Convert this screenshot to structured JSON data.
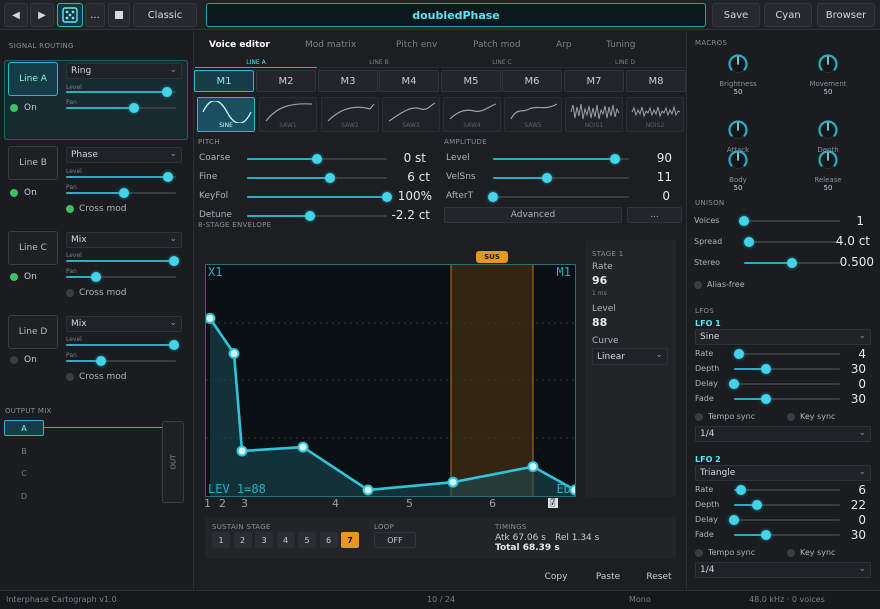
{
  "toolbar": {
    "prev_icon": "play-prev",
    "play_icon": "play",
    "dice_icon": "dice",
    "more_label": "...",
    "stop_icon": "stop",
    "preset_label": "Classic",
    "title": "doubledPhase",
    "save_label": "Save",
    "theme_label": "Cyan",
    "browser_label": "Browser"
  },
  "signal_routing": {
    "title": "SIGNAL ROUTING",
    "lines": [
      {
        "label": "Line A",
        "mode": "Ring",
        "on_label": "On",
        "on": true,
        "level_label": "Level",
        "pan_label": "Pan",
        "level": 0.92,
        "pan": 0.62,
        "cross_mod": null
      },
      {
        "label": "Line B",
        "mode": "Phase",
        "on_label": "On",
        "on": true,
        "level_label": "Level",
        "pan_label": "Pan",
        "level": 0.93,
        "pan": 0.53,
        "cross_mod": {
          "label": "Cross mod",
          "on": true
        }
      },
      {
        "label": "Line C",
        "mode": "Mix",
        "on_label": "On",
        "on": true,
        "level_label": "Level",
        "pan_label": "Pan",
        "level": 0.98,
        "pan": 0.27,
        "cross_mod": {
          "label": "Cross mod",
          "on": false
        }
      },
      {
        "label": "Line D",
        "mode": "Mix",
        "on_label": "On",
        "on": false,
        "level_label": "Level",
        "pan_label": "Pan",
        "level": 0.98,
        "pan": 0.32,
        "cross_mod": {
          "label": "Cross mod",
          "on": false
        }
      }
    ]
  },
  "output_mix": {
    "title": "OUTPUT MIX",
    "buttons": [
      "A",
      "B",
      "C",
      "D"
    ],
    "active": "A",
    "out_label": "OUT"
  },
  "tabs": [
    "Voice editor",
    "Mod matrix",
    "Pitch env",
    "Patch mod",
    "Arp",
    "Tuning"
  ],
  "active_tab": "Voice editor",
  "line_headers": [
    "LINE A",
    "LINE B",
    "LINE C",
    "LINE D"
  ],
  "macro_buttons": [
    "M1",
    "M2",
    "M3",
    "M4",
    "M5",
    "M6",
    "M7",
    "M8"
  ],
  "waves": [
    "SINE",
    "SAW1",
    "SAW2",
    "SAW3",
    "SAW4",
    "SAW5",
    "NOIS1",
    "NOIS2"
  ],
  "pitch": {
    "title": "PITCH",
    "params": [
      {
        "label": "Coarse",
        "value": "0 st",
        "pos": 0.5
      },
      {
        "label": "Fine",
        "value": "6 ct",
        "pos": 0.59
      },
      {
        "label": "KeyFol",
        "value": "100%",
        "pos": 1.0
      },
      {
        "label": "Detune",
        "value": "-2.2 ct",
        "pos": 0.45
      }
    ]
  },
  "amplitude": {
    "title": "AMPLITUDE",
    "params": [
      {
        "label": "Level",
        "value": "90",
        "pos": 0.9
      },
      {
        "label": "VelSns",
        "value": "11",
        "pos": 0.4
      },
      {
        "label": "AfterT",
        "value": "0",
        "pos": 0.0
      }
    ],
    "advanced_label": "Advanced",
    "more_label": "..."
  },
  "envelope": {
    "title": "8-STAGE ENVELOPE",
    "corner_tl": "X1",
    "corner_tr": "M1",
    "corner_bl": "LEV 1=88",
    "corner_br": "ED",
    "sus_label": "SUS",
    "stage_numbers": [
      "1",
      "2",
      "3",
      "4",
      "5",
      "6",
      "7",
      "8"
    ],
    "selected_stage": "7",
    "levels": [
      88,
      70,
      20,
      22,
      0,
      4,
      12,
      0
    ]
  },
  "stage_panel": {
    "title": "STAGE 1",
    "rate_label": "Rate",
    "rate_value": "96",
    "rate_unit": "1 ms",
    "level_label": "Level",
    "level_value": "88",
    "curve_label": "Curve",
    "curve_value": "Linear"
  },
  "sustain": {
    "title": "SUSTAIN STAGE",
    "buttons": [
      "1",
      "2",
      "3",
      "4",
      "5",
      "6",
      "7"
    ],
    "active": "7",
    "loop_title": "LOOP",
    "loop_value": "OFF",
    "timings_title": "TIMINGS",
    "atk": "Atk 67.06 s",
    "rel": "Rel 1.34 s",
    "total": "Total 68.39 s"
  },
  "footer": {
    "copy": "Copy",
    "paste": "Paste",
    "reset": "Reset"
  },
  "macros": {
    "title": "MACROS",
    "knobs": [
      {
        "label": "Brightness",
        "value": "50"
      },
      {
        "label": "Movement",
        "value": "50"
      },
      {
        "label": "Attack",
        "value": "50"
      },
      {
        "label": "Depth",
        "value": "50"
      },
      {
        "label": "Body",
        "value": "50"
      },
      {
        "label": "Release",
        "value": "50"
      }
    ]
  },
  "unison": {
    "title": "UNISON",
    "params": [
      {
        "label": "Voices",
        "value": "1",
        "pos": 0.0
      },
      {
        "label": "Spread",
        "value": "4.0 ct",
        "pos": 0.05
      },
      {
        "label": "Stereo",
        "value": "0.500",
        "pos": 0.5
      }
    ],
    "alias_label": "Alias-free"
  },
  "lfos": {
    "title": "LFOS",
    "items": [
      {
        "title": "LFO 1",
        "wave": "Sine",
        "params": [
          {
            "label": "Rate",
            "value": "4",
            "pos": 0.05
          },
          {
            "label": "Depth",
            "value": "30",
            "pos": 0.3
          },
          {
            "label": "Delay",
            "value": "0",
            "pos": 0.0
          },
          {
            "label": "Fade",
            "value": "30",
            "pos": 0.3
          }
        ],
        "tempo_label": "Tempo sync",
        "key_label": "Key sync",
        "division": "1/4"
      },
      {
        "title": "LFO 2",
        "wave": "Triangle",
        "params": [
          {
            "label": "Rate",
            "value": "6",
            "pos": 0.07
          },
          {
            "label": "Depth",
            "value": "22",
            "pos": 0.22
          },
          {
            "label": "Delay",
            "value": "0",
            "pos": 0.0
          },
          {
            "label": "Fade",
            "value": "30",
            "pos": 0.3
          }
        ],
        "tempo_label": "Tempo sync",
        "key_label": "Key sync",
        "division": "1/4"
      }
    ]
  },
  "status": {
    "app": "Interphase Cartograph v1.0",
    "preset_index": "10 / 24",
    "mode": "Mono",
    "engine": "48.0 kHz · 0 voices"
  },
  "colors": {
    "accent": "#2aaec4",
    "sus": "#e8971e",
    "on": "#3bbf6a"
  }
}
